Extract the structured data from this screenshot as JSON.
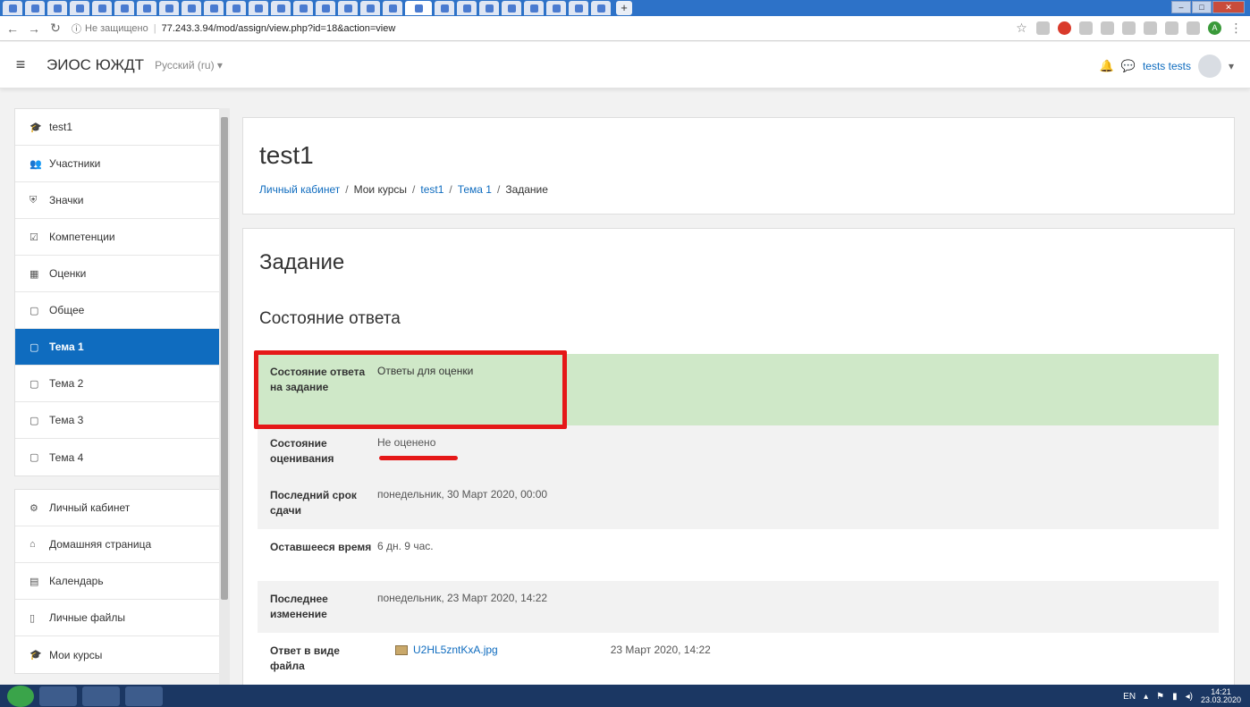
{
  "browser": {
    "tab_count": 27,
    "new_tab_label": "+",
    "security_label": "Не защищено",
    "url": "77.243.3.94/mod/assign/view.php?id=18&action=view",
    "profile_initial": "A"
  },
  "navbar": {
    "brand": "ЭИОС ЮЖДТ",
    "language": "Русский (ru)",
    "username": "tests tests"
  },
  "sidebar": {
    "course_items": [
      {
        "icon": "graduation-cap-icon",
        "glyph": "🎓",
        "label": "test1"
      },
      {
        "icon": "users-icon",
        "glyph": "👥",
        "label": "Участники"
      },
      {
        "icon": "shield-icon",
        "glyph": "⛨",
        "label": "Значки"
      },
      {
        "icon": "checkbox-icon",
        "glyph": "☑",
        "label": "Компетенции"
      },
      {
        "icon": "table-icon",
        "glyph": "▦",
        "label": "Оценки"
      },
      {
        "icon": "folder-icon",
        "glyph": "▢",
        "label": "Общее"
      },
      {
        "icon": "folder-icon",
        "glyph": "▢",
        "label": "Тема 1",
        "active": true
      },
      {
        "icon": "folder-icon",
        "glyph": "▢",
        "label": "Тема 2"
      },
      {
        "icon": "folder-icon",
        "glyph": "▢",
        "label": "Тема 3"
      },
      {
        "icon": "folder-icon",
        "glyph": "▢",
        "label": "Тема 4"
      }
    ],
    "site_items": [
      {
        "icon": "dashboard-icon",
        "glyph": "⚙",
        "label": "Личный кабинет"
      },
      {
        "icon": "home-icon",
        "glyph": "⌂",
        "label": "Домашняя страница"
      },
      {
        "icon": "calendar-icon",
        "glyph": "▤",
        "label": "Календарь"
      },
      {
        "icon": "file-icon",
        "glyph": "▯",
        "label": "Личные файлы"
      },
      {
        "icon": "graduation-cap-icon",
        "glyph": "🎓",
        "label": "Мои курсы"
      }
    ]
  },
  "header": {
    "title": "test1",
    "breadcrumb": [
      "Личный кабинет",
      "Мои курсы",
      "test1",
      "Тема 1",
      "Задание"
    ]
  },
  "main": {
    "activity_title": "Задание",
    "section_title": "Состояние ответа",
    "rows": [
      {
        "label": "Состояние ответа на задание",
        "value": "Ответы для оценки",
        "style": "green"
      },
      {
        "label": "Состояние оценивания",
        "value": "Не оценено",
        "style": "grey"
      },
      {
        "label": "Последний срок сдачи",
        "value": "понедельник, 30 Март 2020, 00:00",
        "style": "grey"
      },
      {
        "label": "Оставшееся время",
        "value": "6 дн. 9 час.",
        "style": "white"
      },
      {
        "label": "Последнее изменение",
        "value": "понедельник, 23 Март 2020, 14:22",
        "style": "grey"
      },
      {
        "label": "Ответ в виде файла",
        "value": "U2HL5zntKxA.jpg",
        "value_date": "23 Март 2020, 14:22",
        "style": "white",
        "is_file": true
      }
    ]
  },
  "taskbar": {
    "language": "EN",
    "time": "14:21",
    "date": "23.03.2020"
  },
  "colors": {
    "accent": "#0f6cbf",
    "annotation_red": "#e51818",
    "submitted_green": "#cfe8c8"
  }
}
